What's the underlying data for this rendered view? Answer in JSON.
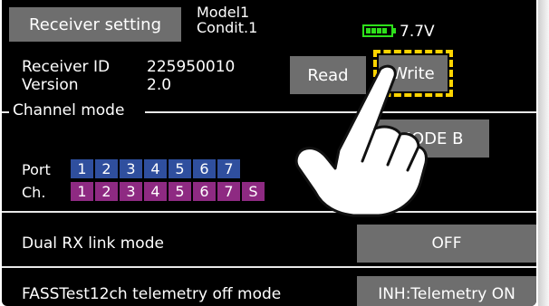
{
  "header": {
    "title": "Receiver setting",
    "model_name": "Model1",
    "condition": "Condit.1",
    "battery_voltage": "7.7V",
    "battery_level": 1.0
  },
  "receiver": {
    "id_label": "Receiver ID",
    "id_value": "225950010",
    "version_label": "Version",
    "version_value": "2.0",
    "read_label": "Read",
    "write_label": "Write"
  },
  "channel_mode": {
    "section_label": "Channel mode",
    "mode_value": "MODE B",
    "port_label": "Port",
    "ch_label": "Ch.",
    "ports": [
      "1",
      "2",
      "3",
      "4",
      "5",
      "6",
      "7"
    ],
    "channels": [
      "1",
      "2",
      "3",
      "4",
      "5",
      "6",
      "7",
      "S"
    ]
  },
  "settings": {
    "dual_rx_label": "Dual RX link mode",
    "dual_rx_value": "OFF",
    "fasstest_label": "FASSTest12ch telemetry off mode",
    "fasstest_value": "INH:Telemetry ON"
  },
  "colors": {
    "port_cell": "#2f4f9e",
    "ch_cell": "#8e2a82",
    "button": "#6e6e6e",
    "highlight": "#ffd400",
    "battery": "#2ee01b"
  }
}
